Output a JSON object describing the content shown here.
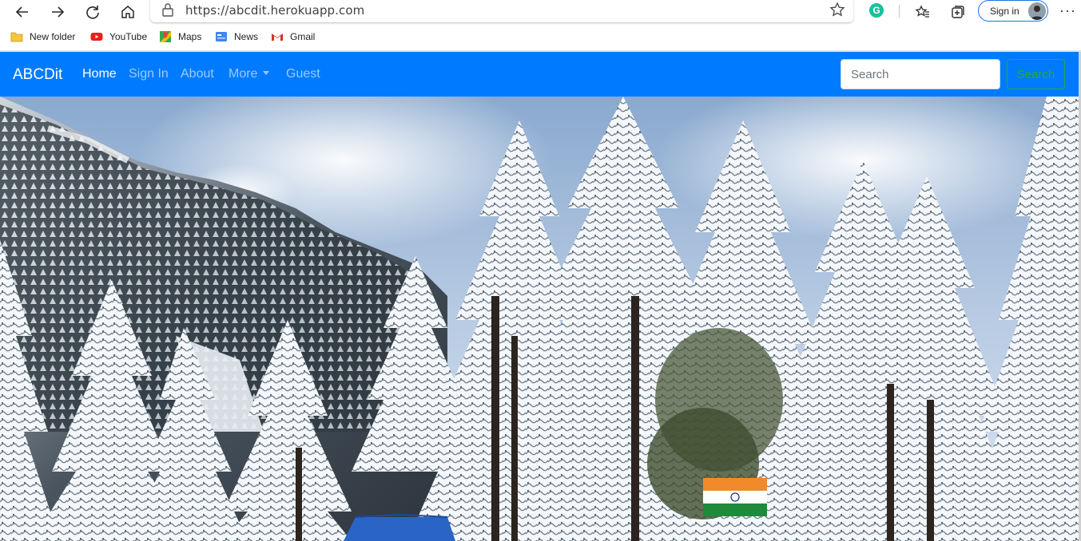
{
  "browser": {
    "url": "https://abcdit.herokuapp.com",
    "sign_in_label": "Sign in",
    "icons": [
      "back-icon",
      "forward-icon",
      "refresh-icon",
      "home-icon",
      "lock-icon",
      "favorite-star-icon",
      "grammarly-icon",
      "favorites-icon",
      "collections-icon",
      "more-icon"
    ]
  },
  "bookmarks": [
    {
      "label": "New folder",
      "icon": "folder-icon"
    },
    {
      "label": "YouTube",
      "icon": "youtube-icon"
    },
    {
      "label": "Maps",
      "icon": "maps-icon"
    },
    {
      "label": "News",
      "icon": "news-icon"
    },
    {
      "label": "Gmail",
      "icon": "gmail-icon"
    }
  ],
  "navbar": {
    "brand": "ABCDit",
    "links": [
      "Home",
      "Sign In",
      "About",
      "More",
      "Guest"
    ],
    "active_link": "Home",
    "search_placeholder": "Search",
    "search_button": "Search"
  },
  "colors": {
    "navbar_bg": "#007bff",
    "search_button": "#28a745"
  }
}
